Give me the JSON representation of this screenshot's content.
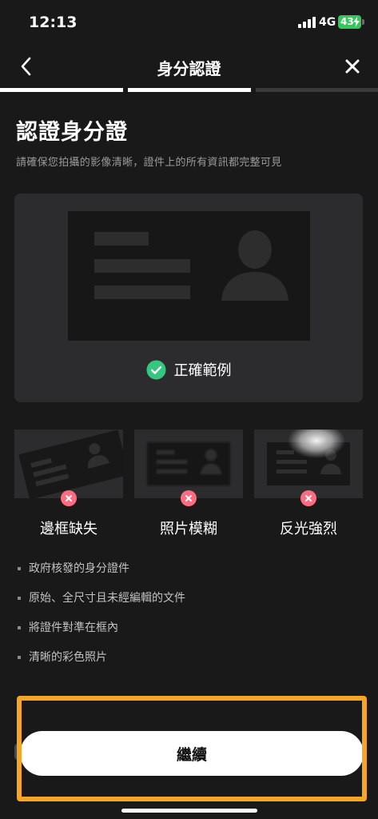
{
  "status_bar": {
    "time": "12:13",
    "network": "4G",
    "battery": "43"
  },
  "header": {
    "title": "身分認證",
    "back_icon": "chevron-left-icon",
    "close_icon": "close-icon"
  },
  "progress": {
    "total_steps": 3,
    "current_step": 2
  },
  "content": {
    "title": "認證身分證",
    "subtitle": "請確保您拍攝的影像清晰，證件上的所有資訊都完整可見",
    "example_caption": "正確範例",
    "bad_examples": [
      {
        "label": "邊框缺失"
      },
      {
        "label": "照片模糊"
      },
      {
        "label": "反光強烈"
      }
    ],
    "requirements": [
      "政府核發的身分證件",
      "原始、全尺寸且未經編輯的文件",
      "將證件對準在框內",
      "清晰的彩色照片"
    ]
  },
  "actions": {
    "continue_label": "繼續"
  },
  "colors": {
    "background": "#191919",
    "card": "#2c2c2e",
    "success": "#34c77f",
    "error": "#ff6b80",
    "highlight": "#f5a623",
    "battery": "#34c759"
  }
}
